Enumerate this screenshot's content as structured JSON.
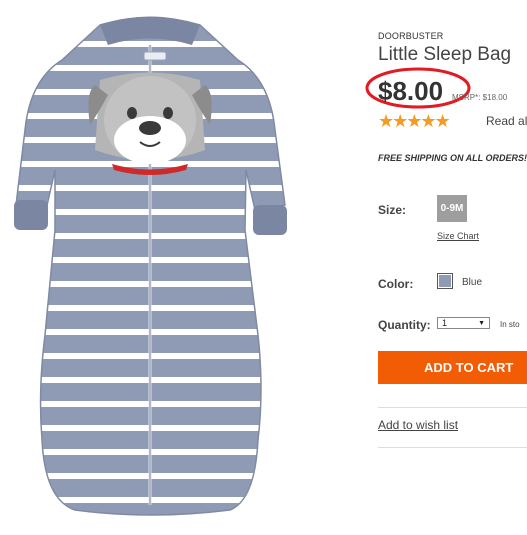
{
  "product": {
    "eyebrow": "DOORBUSTER",
    "title": "Little Sleep Bag",
    "price": "$8.00",
    "msrp": "MSRP*: $18.00",
    "rating_stars": 5,
    "stars_glyphs": "★★★★★",
    "read_all": "Read al",
    "shipping": "FREE SHIPPING ON ALL ORDERS!"
  },
  "options": {
    "size_label": "Size:",
    "size_value": "0-9M",
    "size_chart": "Size Chart",
    "color_label": "Color:",
    "color_name": "Blue",
    "color_swatch": "#8f9bb5",
    "quantity_label": "Quantity:",
    "quantity_value": "1",
    "stock": "In sto"
  },
  "actions": {
    "add_to_cart": "ADD TO CART",
    "wishlist": "Add to wish list"
  },
  "colors": {
    "accent": "#f25c05",
    "stars": "#f59a23",
    "highlight_circle": "#e01b24",
    "garment_stripe": "#8f9bb5"
  }
}
